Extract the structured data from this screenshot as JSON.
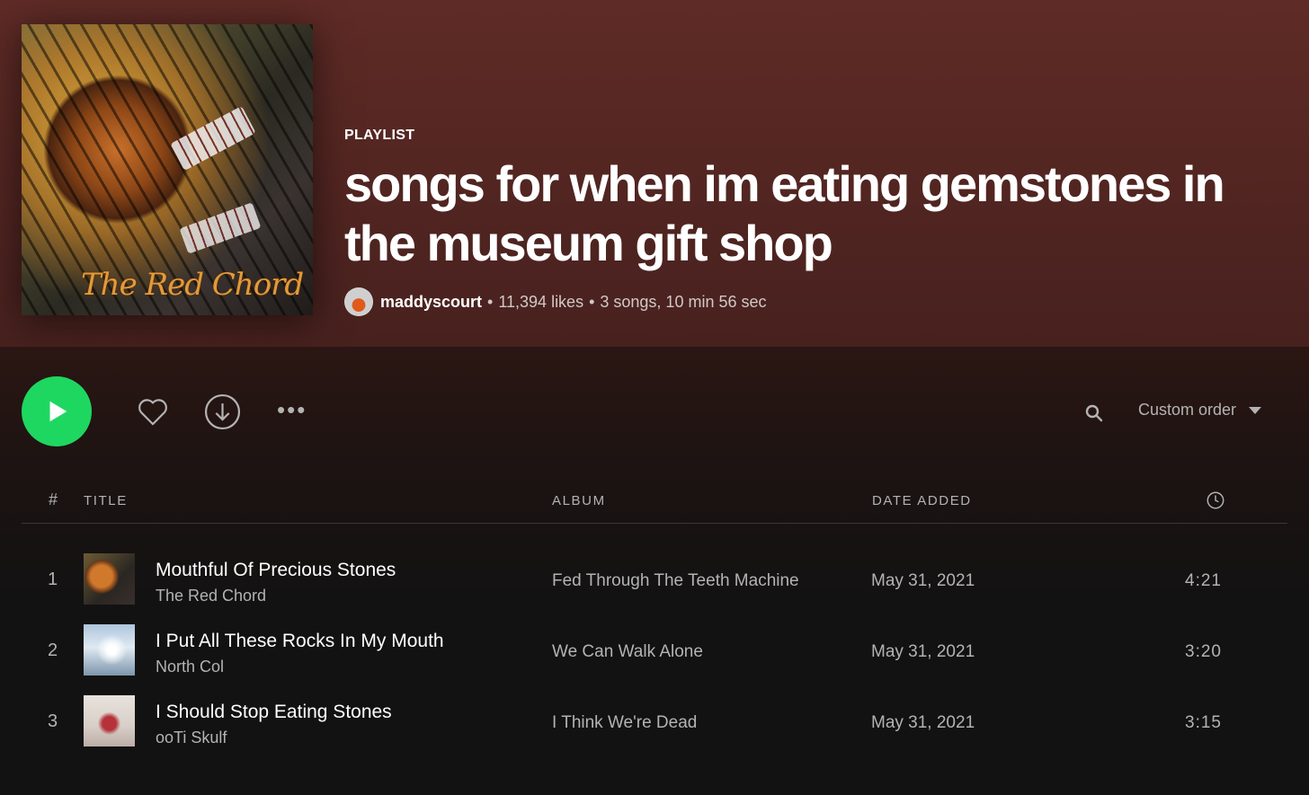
{
  "header": {
    "type_label": "PLAYLIST",
    "title": "songs for when im eating gemstones in the museum gift shop",
    "owner": "maddyscourt",
    "likes": "11,394 likes",
    "summary": "3 songs, 10 min 56 sec",
    "separator": "•",
    "cover_logo_text": "The Red Chord"
  },
  "controls": {
    "more_label": "•••",
    "sort_label": "Custom order",
    "icons": [
      "play-icon",
      "heart-icon",
      "download-icon",
      "more-icon",
      "search-icon",
      "chevron-down-icon"
    ],
    "accent_color": "#1ed760"
  },
  "table": {
    "headers": {
      "num": "#",
      "title": "TITLE",
      "album": "ALBUM",
      "date": "DATE ADDED",
      "duration_icon": "clock-icon"
    },
    "rows": [
      {
        "num": "1",
        "title": "Mouthful Of Precious Stones",
        "artist": "The Red Chord",
        "album": "Fed Through The Teeth Machine",
        "date": "May 31, 2021",
        "duration": "4:21"
      },
      {
        "num": "2",
        "title": "I Put All These Rocks In My Mouth",
        "artist": "North Col",
        "album": "We Can Walk Alone",
        "date": "May 31, 2021",
        "duration": "3:20"
      },
      {
        "num": "3",
        "title": "I Should Stop Eating Stones",
        "artist": "ooTi Skulf",
        "album": "I Think We're Dead",
        "date": "May 31, 2021",
        "duration": "3:15"
      }
    ]
  }
}
